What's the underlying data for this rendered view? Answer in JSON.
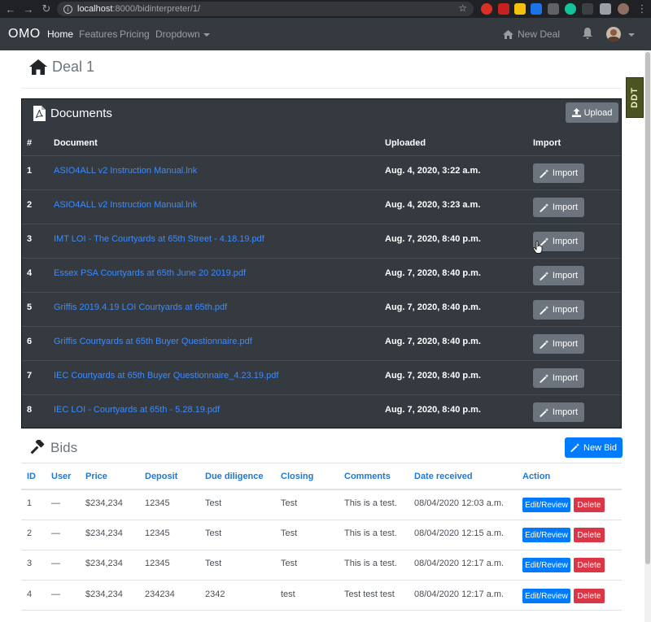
{
  "browser": {
    "url_host": "localhost",
    "url_path": ":8000/bidinterpreter/1/"
  },
  "navbar": {
    "brand": "OMO",
    "links": [
      "Home",
      "Features",
      "Pricing",
      "Dropdown"
    ],
    "new_deal": "New Deal"
  },
  "page": {
    "title": "Deal 1",
    "badge": "DDT"
  },
  "documents": {
    "title": "Documents",
    "upload_label": "Upload",
    "headers": [
      "#",
      "Document",
      "Uploaded",
      "Import"
    ],
    "import_label": "Import",
    "rows": [
      {
        "num": "1",
        "name": "ASIO4ALL v2 Instruction Manual.lnk",
        "uploaded": "Aug. 4, 2020, 3:22 a.m."
      },
      {
        "num": "2",
        "name": "ASIO4ALL v2 Instruction Manual.lnk",
        "uploaded": "Aug. 4, 2020, 3:23 a.m."
      },
      {
        "num": "3",
        "name": "IMT LOI - The Courtyards at 65th Street - 4.18.19.pdf",
        "uploaded": "Aug. 7, 2020, 8:40 p.m."
      },
      {
        "num": "4",
        "name": "Essex PSA Courtyards at 65th June 20 2019.pdf",
        "uploaded": "Aug. 7, 2020, 8:40 p.m."
      },
      {
        "num": "5",
        "name": "Griffis 2019.4.19 LOI Courtyards at 65th.pdf",
        "uploaded": "Aug. 7, 2020, 8:40 p.m."
      },
      {
        "num": "6",
        "name": "Griffis Courtyards at 65th Buyer Questionnaire.pdf",
        "uploaded": "Aug. 7, 2020, 8:40 p.m."
      },
      {
        "num": "7",
        "name": "IEC Courtyards at 65th Buyer Questionnaire_4.23.19.pdf",
        "uploaded": "Aug. 7, 2020, 8:40 p.m."
      },
      {
        "num": "8",
        "name": "IEC LOI - Courtyards at 65th - 5.28.19.pdf",
        "uploaded": "Aug. 7, 2020, 8:40 p.m."
      }
    ]
  },
  "bids": {
    "title": "Bids",
    "new_bid_label": "New Bid",
    "headers": [
      "ID",
      "User",
      "Price",
      "Deposit",
      "Due diligence",
      "Closing",
      "Comments",
      "Date received",
      "Action"
    ],
    "edit_label": "Edit/Review",
    "delete_label": "Delete",
    "rows": [
      {
        "id": "1",
        "user": "—",
        "price": "$234,234",
        "deposit": "12345",
        "due": "Test",
        "closing": "Test",
        "comments": "This is a test.",
        "date": "08/04/2020 12:03 a.m."
      },
      {
        "id": "2",
        "user": "—",
        "price": "$234,234",
        "deposit": "12345",
        "due": "Test",
        "closing": "Test",
        "comments": "This is a test.",
        "date": "08/04/2020 12:15 a.m."
      },
      {
        "id": "3",
        "user": "—",
        "price": "$234,234",
        "deposit": "12345",
        "due": "Test",
        "closing": "Test",
        "comments": "This is a test.",
        "date": "08/04/2020 12:17 a.m."
      },
      {
        "id": "4",
        "user": "—",
        "price": "$234,234",
        "deposit": "234234",
        "due": "2342",
        "closing": "test",
        "comments": "Test test test",
        "date": "08/04/2020 12:17 a.m."
      }
    ]
  },
  "colors": {
    "navbar": "#343a40",
    "primary": "#007bff",
    "danger": "#dc3545",
    "secondary": "#6c757d",
    "link": "#3d8bfd"
  }
}
